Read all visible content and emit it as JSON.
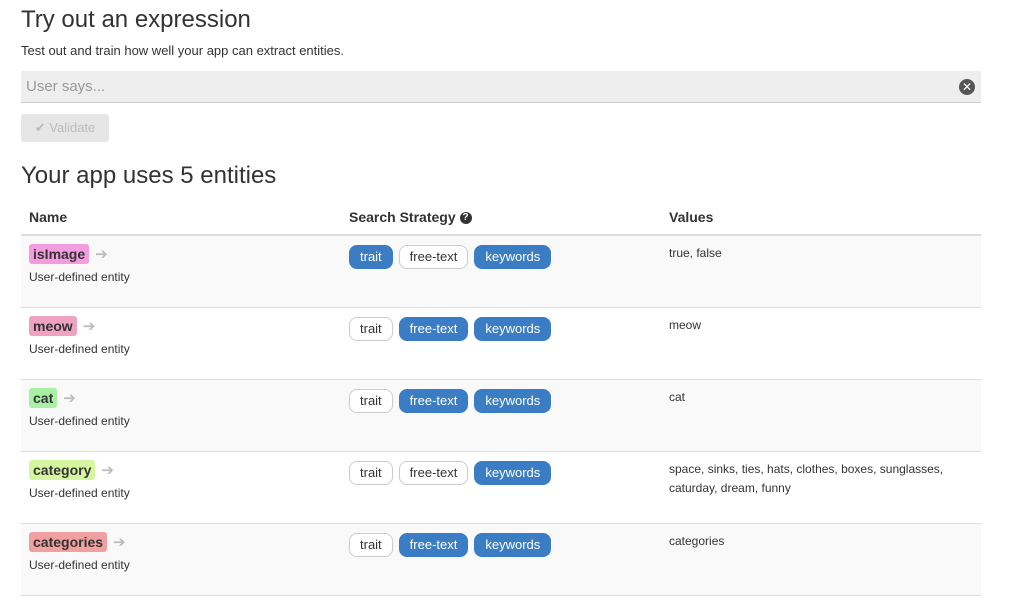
{
  "try": {
    "title": "Try out an expression",
    "subtitle": "Test out and train how well your app can extract entities.",
    "placeholder": "User says...",
    "validate_label": "Validate"
  },
  "entities": {
    "title": "Your app uses 5 entities",
    "headers": {
      "name": "Name",
      "strategy": "Search Strategy",
      "values": "Values"
    },
    "rows": [
      {
        "name": "isImage",
        "color": "#f49ce0",
        "desc": "User-defined entity",
        "trait": true,
        "free_text": false,
        "keywords": true,
        "values": "true, false"
      },
      {
        "name": "meow",
        "color": "#f0a3c0",
        "desc": "User-defined entity",
        "trait": false,
        "free_text": true,
        "keywords": true,
        "values": "meow"
      },
      {
        "name": "cat",
        "color": "#a8f0a4",
        "desc": "User-defined entity",
        "trait": false,
        "free_text": true,
        "keywords": true,
        "values": "cat"
      },
      {
        "name": "category",
        "color": "#d6f5a0",
        "desc": "User-defined entity",
        "trait": false,
        "free_text": false,
        "keywords": true,
        "values": "space, sinks, ties, hats, clothes, boxes, sunglasses, caturday, dream, funny"
      },
      {
        "name": "categories",
        "color": "#f0a0a0",
        "desc": "User-defined entity",
        "trait": false,
        "free_text": true,
        "keywords": true,
        "values": "categories"
      }
    ],
    "strategy_labels": {
      "trait": "trait",
      "free_text": "free-text",
      "keywords": "keywords"
    }
  }
}
